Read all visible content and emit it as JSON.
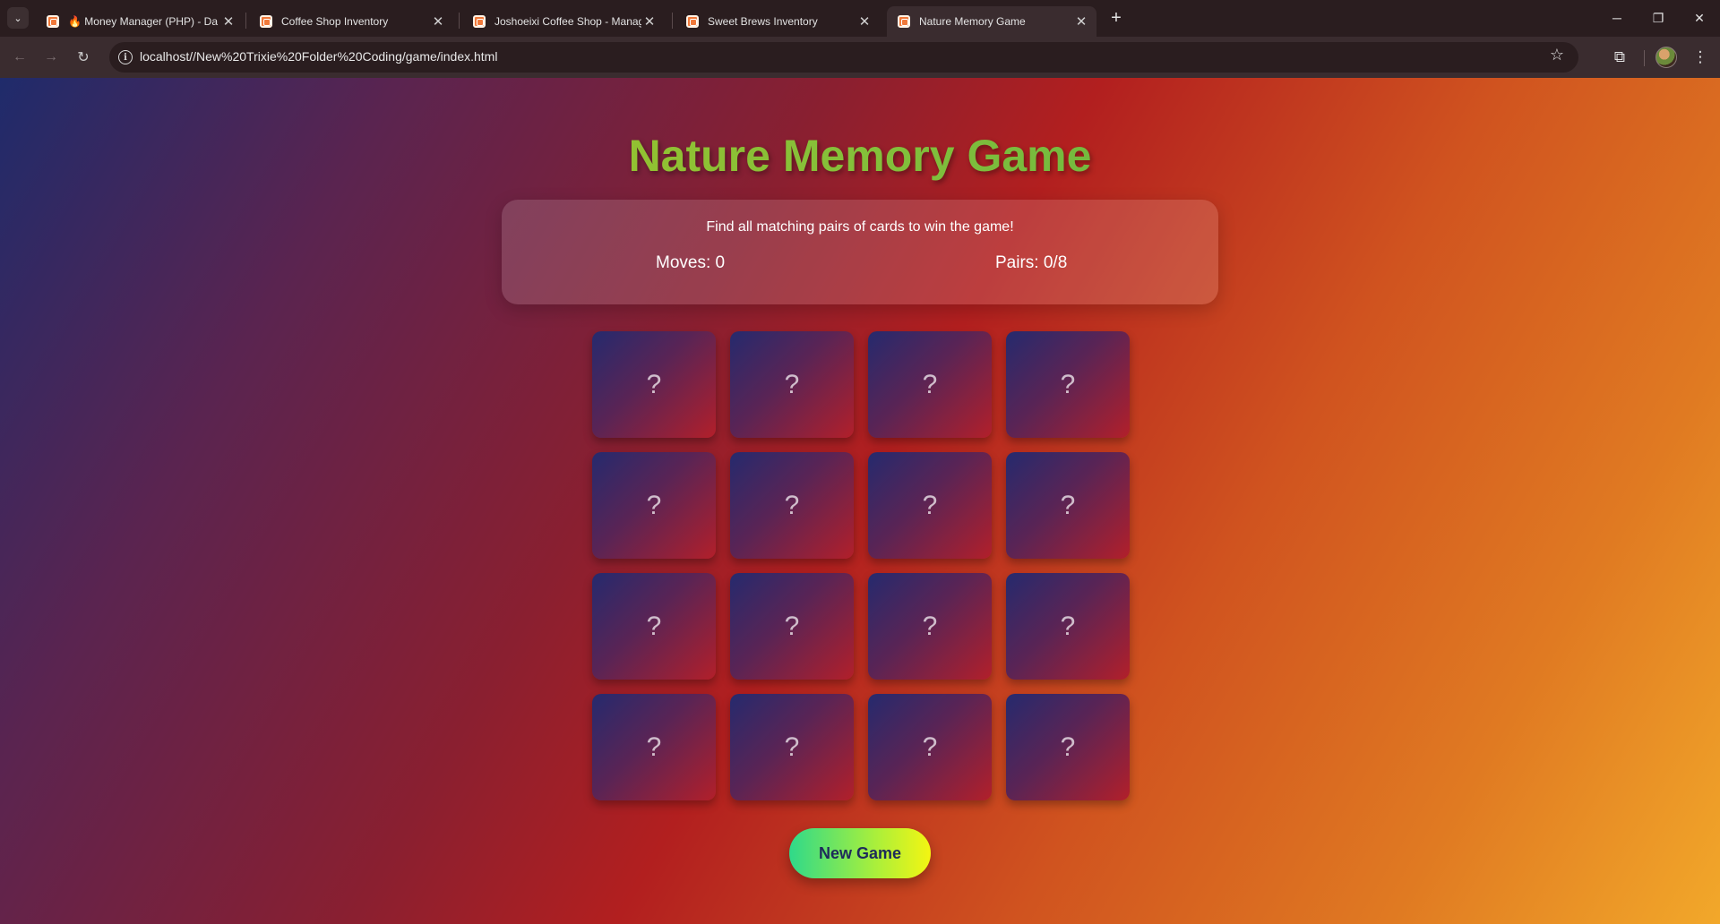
{
  "browser": {
    "tabs": [
      {
        "title": "🔥 Money Manager (PHP) - Da",
        "active": false
      },
      {
        "title": "Coffee Shop Inventory",
        "active": false
      },
      {
        "title": "Joshoeixi Coffee Shop - Manag",
        "active": false
      },
      {
        "title": "Sweet Brews Inventory",
        "active": false
      },
      {
        "title": "Nature Memory Game",
        "active": true
      }
    ],
    "url": "localhost//New%20Trixie%20Folder%20Coding/game/index.html"
  },
  "game": {
    "title": "Nature Memory Game",
    "instructions": "Find all matching pairs of cards to win the game!",
    "moves_text": "Moves: 0",
    "pairs_text": "Pairs: 0/8",
    "card_face": "?",
    "card_count": 16,
    "new_game_label": "New Game"
  },
  "colors": {
    "title_gradient": [
      "#b7c41a",
      "#4aa94a"
    ],
    "button_gradient": [
      "#2fd98a",
      "#f4f512"
    ],
    "card_gradient": [
      "#252a6e",
      "#b21f2a"
    ]
  }
}
